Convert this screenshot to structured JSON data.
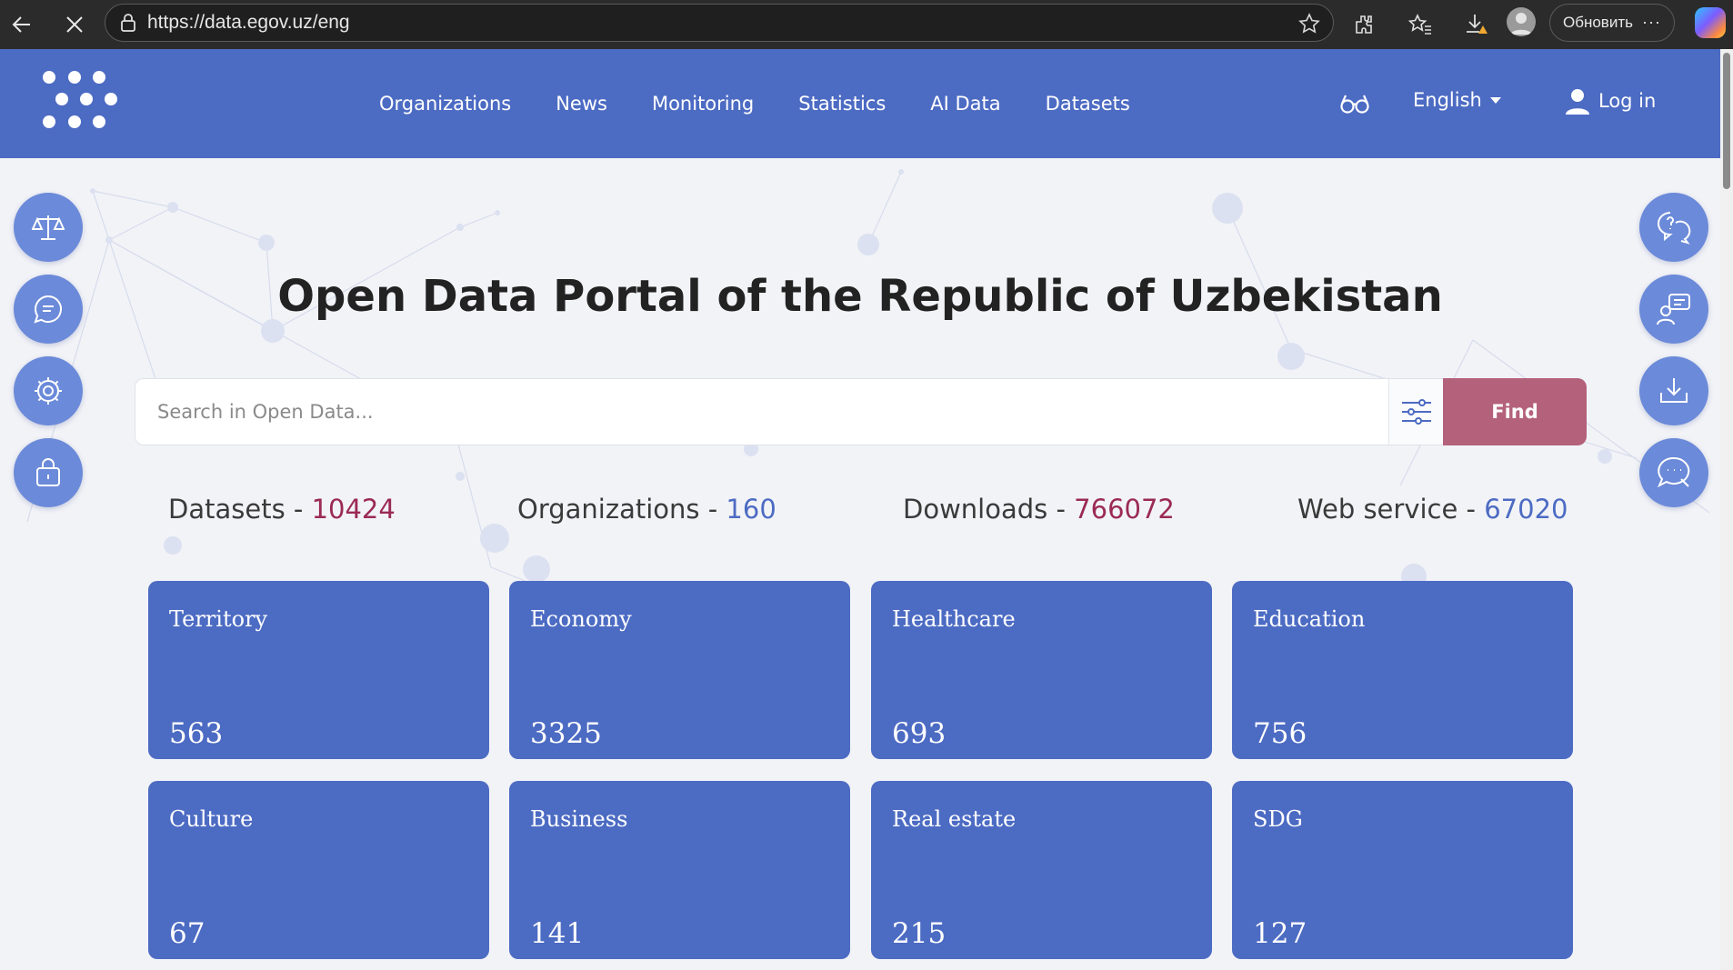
{
  "browser": {
    "url": "https://data.egov.uz/eng",
    "update_label": "Обновить",
    "more_label": "···"
  },
  "header": {
    "nav": [
      "Organizations",
      "News",
      "Monitoring",
      "Statistics",
      "AI Data",
      "Datasets"
    ],
    "language": "English",
    "login": "Log in"
  },
  "page": {
    "title": "Open Data Portal of the Republic of Uzbekistan"
  },
  "search": {
    "placeholder": "Search in Open Data...",
    "button": "Find"
  },
  "stats": [
    {
      "label": "Datasets - ",
      "value": "10424",
      "color": "red"
    },
    {
      "label": "Organizations - ",
      "value": "160",
      "color": "blue"
    },
    {
      "label": "Downloads - ",
      "value": "766072",
      "color": "red"
    },
    {
      "label": "Web service - ",
      "value": "67020",
      "color": "blue"
    }
  ],
  "categories": [
    {
      "name": "Territory",
      "count": "563"
    },
    {
      "name": "Economy",
      "count": "3325"
    },
    {
      "name": "Healthcare",
      "count": "693"
    },
    {
      "name": "Education",
      "count": "756"
    },
    {
      "name": "Culture",
      "count": "67"
    },
    {
      "name": "Business",
      "count": "141"
    },
    {
      "name": "Real estate",
      "count": "215"
    },
    {
      "name": "SDG",
      "count": "127"
    }
  ],
  "side_left_icons": [
    "scales-icon",
    "chat-bubble-icon",
    "gear-icon",
    "lock-bag-icon"
  ],
  "side_right_icons": [
    "help-chat-icon",
    "feedback-icon",
    "download-icon",
    "support-chat-icon"
  ],
  "colors": {
    "header": "#4c6bc3",
    "card": "#4c6bc3",
    "find_button": "#b4617b",
    "stat_red": "#9b2a55",
    "stat_blue": "#4c6bc3",
    "side_button": "#6b8ad9"
  }
}
